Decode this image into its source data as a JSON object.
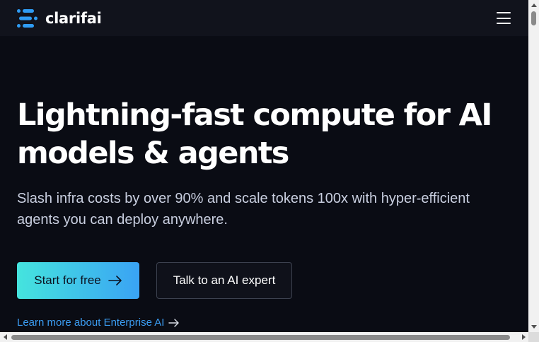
{
  "navbar": {
    "logo_text": "clarifai",
    "menu_icon": "hamburger-icon"
  },
  "hero": {
    "title_line1": "Lightning-fast compute for AI",
    "title_line2": "models & agents",
    "subtitle_line1": "Slash infra costs by over 90% and scale tokens 100x with hyper-efficient",
    "subtitle_line2": "agents you can deploy anywhere."
  },
  "cta": {
    "primary_label": "Start for free",
    "secondary_label": "Talk to an AI expert",
    "link_label": "Learn more about Enterprise AI"
  },
  "colors": {
    "background": "#0a0c14",
    "navbar": "#11131c",
    "gradient_start": "#45e4de",
    "gradient_end": "#3aa3f4",
    "link": "#3b9cf1",
    "logo_accent": "#2f9cf4"
  },
  "icons": {
    "logo": "clarifai-logo-icon",
    "primary_arrow": "arrow-right-icon",
    "link_arrow": "arrow-right-icon"
  }
}
